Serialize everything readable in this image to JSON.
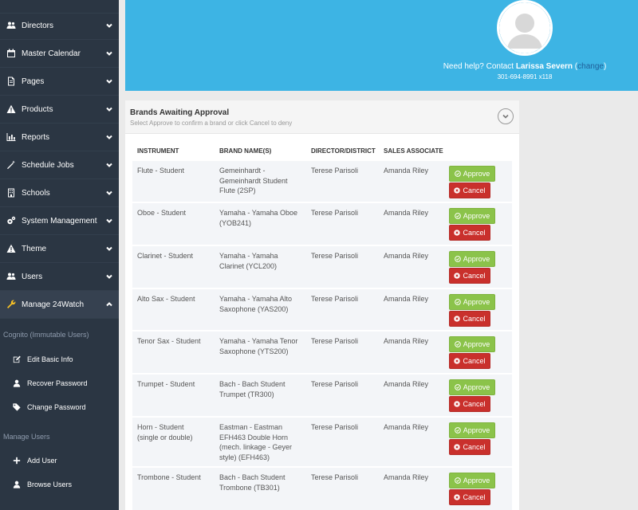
{
  "sidebar": {
    "items": [
      {
        "label": "Directors",
        "icon": "users-icon"
      },
      {
        "label": "Master Calendar",
        "icon": "calendar-icon"
      },
      {
        "label": "Pages",
        "icon": "file-icon"
      },
      {
        "label": "Products",
        "icon": "warning-icon"
      },
      {
        "label": "Reports",
        "icon": "bar-chart-icon"
      },
      {
        "label": "Schedule Jobs",
        "icon": "wand-icon"
      },
      {
        "label": "Schools",
        "icon": "building-icon"
      },
      {
        "label": "System Management",
        "icon": "cogs-icon"
      },
      {
        "label": "Theme",
        "icon": "warning-icon"
      },
      {
        "label": "Users",
        "icon": "users-icon"
      },
      {
        "label": "Manage 24Watch",
        "icon": "wrench-icon"
      }
    ],
    "section1": "Cognito (Immutable Users)",
    "section1_items": [
      {
        "label": "Edit Basic Info",
        "icon": "edit-icon"
      },
      {
        "label": "Recover Password",
        "icon": "user-icon"
      },
      {
        "label": "Change Password",
        "icon": "tag-icon"
      }
    ],
    "section2": "Manage Users",
    "section2_items": [
      {
        "label": "Add User",
        "icon": "plus-icon"
      },
      {
        "label": "Browse Users",
        "icon": "user-icon"
      }
    ]
  },
  "help": {
    "prefix": "Need help? Contact ",
    "name": "Larissa Severn",
    "open": " (",
    "change": "change",
    "close": ")",
    "phone": "301-694-8991 x118"
  },
  "panel": {
    "title": "Brands Awaiting Approval",
    "subtitle": "Select Approve to confirm a brand or click Cancel to deny",
    "headers": [
      "INSTRUMENT",
      "BRAND NAME(S)",
      "DIRECTOR/DISTRICT",
      "SALES ASSOCIATE"
    ],
    "approve_label": "Approve",
    "cancel_label": "Cancel",
    "rows": [
      {
        "instrument": [
          "Flute - Student"
        ],
        "brand": [
          "Gemeinhardt -",
          "Gemeinhardt Student",
          "Flute (2SP)"
        ],
        "director": "Terese Parisoli",
        "associate": "Amanda Riley"
      },
      {
        "instrument": [
          "Oboe - Student"
        ],
        "brand": [
          "Yamaha - Yamaha Oboe",
          "(YOB241)"
        ],
        "director": "Terese Parisoli",
        "associate": "Amanda Riley"
      },
      {
        "instrument": [
          "Clarinet - Student"
        ],
        "brand": [
          "Yamaha - Yamaha",
          "Clarinet (YCL200)"
        ],
        "director": "Terese Parisoli",
        "associate": "Amanda Riley"
      },
      {
        "instrument": [
          "Alto Sax - Student"
        ],
        "brand": [
          "Yamaha - Yamaha Alto",
          "Saxophone (YAS200)"
        ],
        "director": "Terese Parisoli",
        "associate": "Amanda Riley"
      },
      {
        "instrument": [
          "Tenor Sax - Student"
        ],
        "brand": [
          "Yamaha - Yamaha Tenor",
          "Saxophone (YTS200)"
        ],
        "director": "Terese Parisoli",
        "associate": "Amanda Riley"
      },
      {
        "instrument": [
          "Trumpet - Student"
        ],
        "brand": [
          "Bach - Bach Student",
          "Trumpet (TR300)"
        ],
        "director": "Terese Parisoli",
        "associate": "Amanda Riley"
      },
      {
        "instrument": [
          "Horn - Student",
          "(single or double)"
        ],
        "brand": [
          "Eastman - Eastman",
          "EFH463 Double Horn",
          "(mech. linkage - Geyer",
          "style) (EFH463)"
        ],
        "director": "Terese Parisoli",
        "associate": "Amanda Riley"
      },
      {
        "instrument": [
          "Trombone - Student"
        ],
        "brand": [
          "Bach - Bach Student",
          "Trombone (TB301)"
        ],
        "director": "Terese Parisoli",
        "associate": "Amanda Riley"
      }
    ]
  }
}
